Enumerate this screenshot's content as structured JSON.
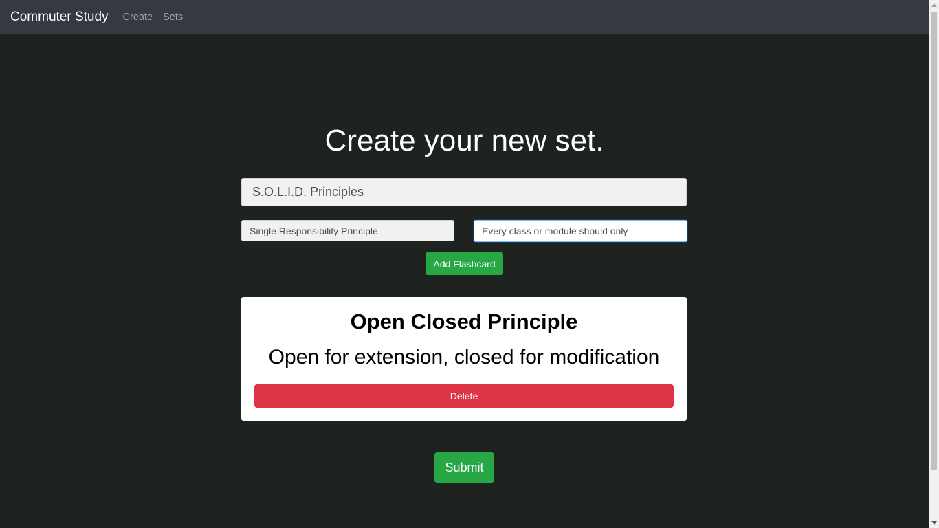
{
  "navbar": {
    "brand": "Commuter Study",
    "links": [
      "Create",
      "Sets"
    ]
  },
  "page": {
    "heading": "Create your new set."
  },
  "form": {
    "set_title_value": "S.O.L.I.D. Principles",
    "term_value": "Single Responsibility Principle",
    "definition_value": "Every class or module should only",
    "add_label": "Add Flashcard"
  },
  "flashcards": [
    {
      "term": "Open Closed Principle",
      "definition": "Open for extension, closed for modification",
      "delete_label": "Delete"
    }
  ],
  "submit_label": "Submit",
  "colors": {
    "navbar_bg": "#343a40",
    "page_bg": "#1e2320",
    "success": "#28a745",
    "danger": "#dc3545"
  }
}
